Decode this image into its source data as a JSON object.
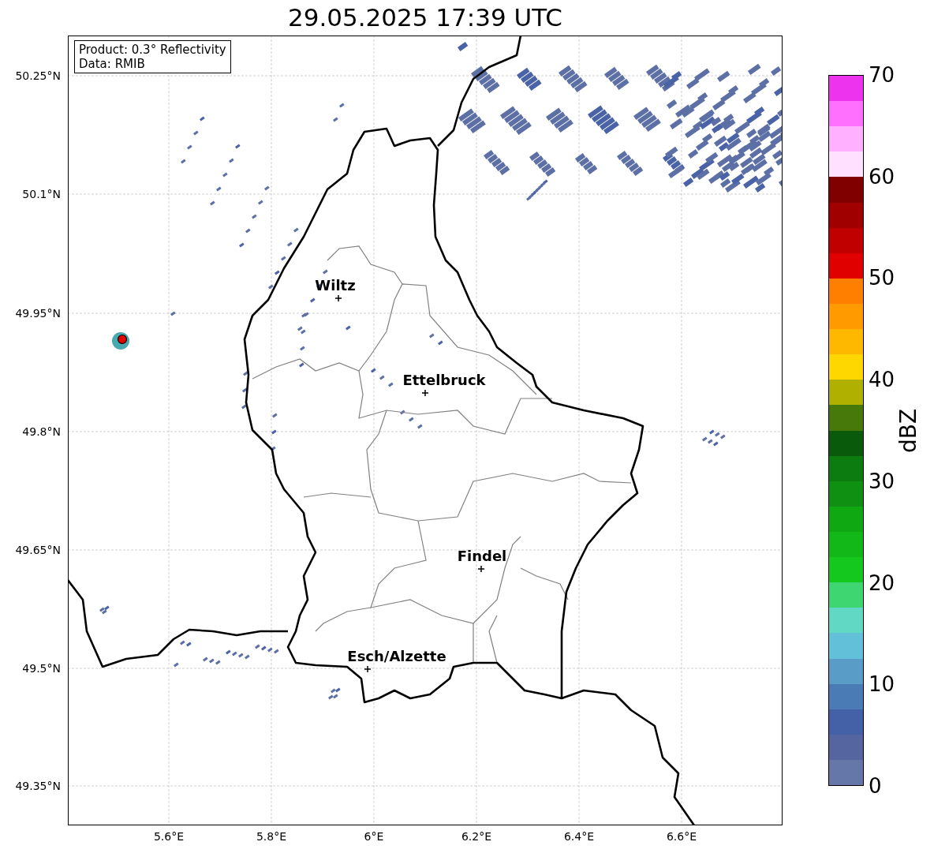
{
  "title": "29.05.2025 17:39 UTC",
  "info_box": {
    "lines": [
      "Product: 0.3° Reflectivity",
      "Data: RMIB"
    ]
  },
  "map": {
    "y_ticks": [
      "50.25°N",
      "50.1°N",
      "49.95°N",
      "49.8°N",
      "49.65°N",
      "49.5°N",
      "49.35°N"
    ],
    "x_ticks": [
      "5.6°E",
      "5.8°E",
      "6°E",
      "6.2°E",
      "6.4°E",
      "6.6°E"
    ],
    "places": [
      {
        "name": "Wiltz"
      },
      {
        "name": "Ettelbruck"
      },
      {
        "name": "Findel"
      },
      {
        "name": "Esch/Alzette"
      }
    ]
  },
  "colorbar": {
    "label": "dBZ",
    "ticks": [
      "70",
      "60",
      "50",
      "40",
      "30",
      "20",
      "10",
      "0"
    ],
    "bins": [
      {
        "color": "#ee33ee"
      },
      {
        "color": "#ff70ff"
      },
      {
        "color": "#ffb0ff"
      },
      {
        "color": "#ffe0ff"
      },
      {
        "color": "#800000"
      },
      {
        "color": "#a00000"
      },
      {
        "color": "#c00000"
      },
      {
        "color": "#e00000"
      },
      {
        "color": "#ff7f00"
      },
      {
        "color": "#ff9a00"
      },
      {
        "color": "#ffb800"
      },
      {
        "color": "#ffd700"
      },
      {
        "color": "#b0b000"
      },
      {
        "color": "#46780a"
      },
      {
        "color": "#0a5a0c"
      },
      {
        "color": "#0c7c10"
      },
      {
        "color": "#0f9012"
      },
      {
        "color": "#10a812"
      },
      {
        "color": "#12b818"
      },
      {
        "color": "#14c81e"
      },
      {
        "color": "#3ed670"
      },
      {
        "color": "#60d8c4"
      },
      {
        "color": "#62c0d8"
      },
      {
        "color": "#5a9cc8"
      },
      {
        "color": "#4a7bb4"
      },
      {
        "color": "#4460a6"
      },
      {
        "color": "#5465a0"
      },
      {
        "color": "#6577a8"
      }
    ]
  }
}
